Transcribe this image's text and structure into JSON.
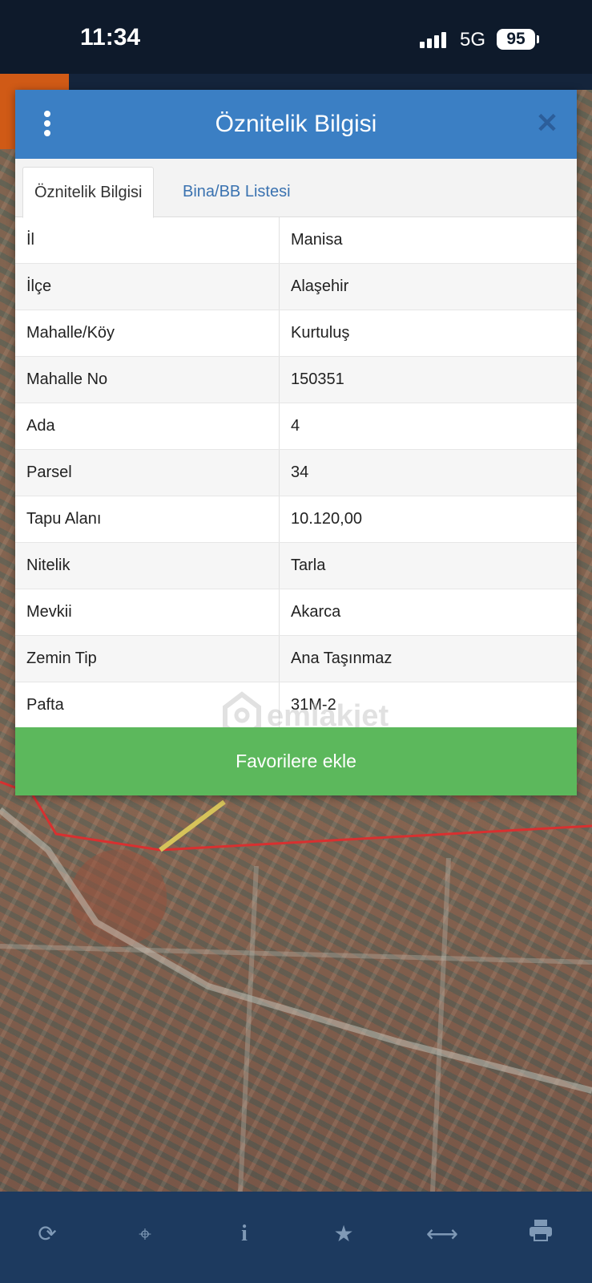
{
  "status_bar": {
    "time": "11:34",
    "network": "5G",
    "battery": "95"
  },
  "modal": {
    "title": "Öznitelik Bilgisi",
    "close_icon": "close-icon",
    "tabs": [
      {
        "label": "Öznitelik Bilgisi",
        "active": true
      },
      {
        "label": "Bina/BB Listesi",
        "active": false
      }
    ],
    "rows": [
      {
        "key": "İl",
        "value": "Manisa"
      },
      {
        "key": "İlçe",
        "value": "Alaşehir"
      },
      {
        "key": "Mahalle/Köy",
        "value": "Kurtuluş"
      },
      {
        "key": "Mahalle No",
        "value": "150351"
      },
      {
        "key": "Ada",
        "value": "4"
      },
      {
        "key": "Parsel",
        "value": "34"
      },
      {
        "key": "Tapu Alanı",
        "value": "10.120,00"
      },
      {
        "key": "Nitelik",
        "value": "Tarla"
      },
      {
        "key": "Mevkii",
        "value": "Akarca"
      },
      {
        "key": "Zemin Tip",
        "value": "Ana Taşınmaz"
      },
      {
        "key": "Pafta",
        "value": "31M-2"
      }
    ],
    "favorite_button": "Favorilere ekle"
  },
  "watermark": "emlakjet",
  "toolbar": {
    "icons": [
      "refresh-icon",
      "locate-icon",
      "info-icon",
      "star-icon",
      "measure-icon",
      "print-icon"
    ]
  },
  "colors": {
    "header": "#3b7fc4",
    "favorite": "#5cb85c",
    "toolbar": "#1d3a5f",
    "statusbar": "#0e1a2b"
  }
}
